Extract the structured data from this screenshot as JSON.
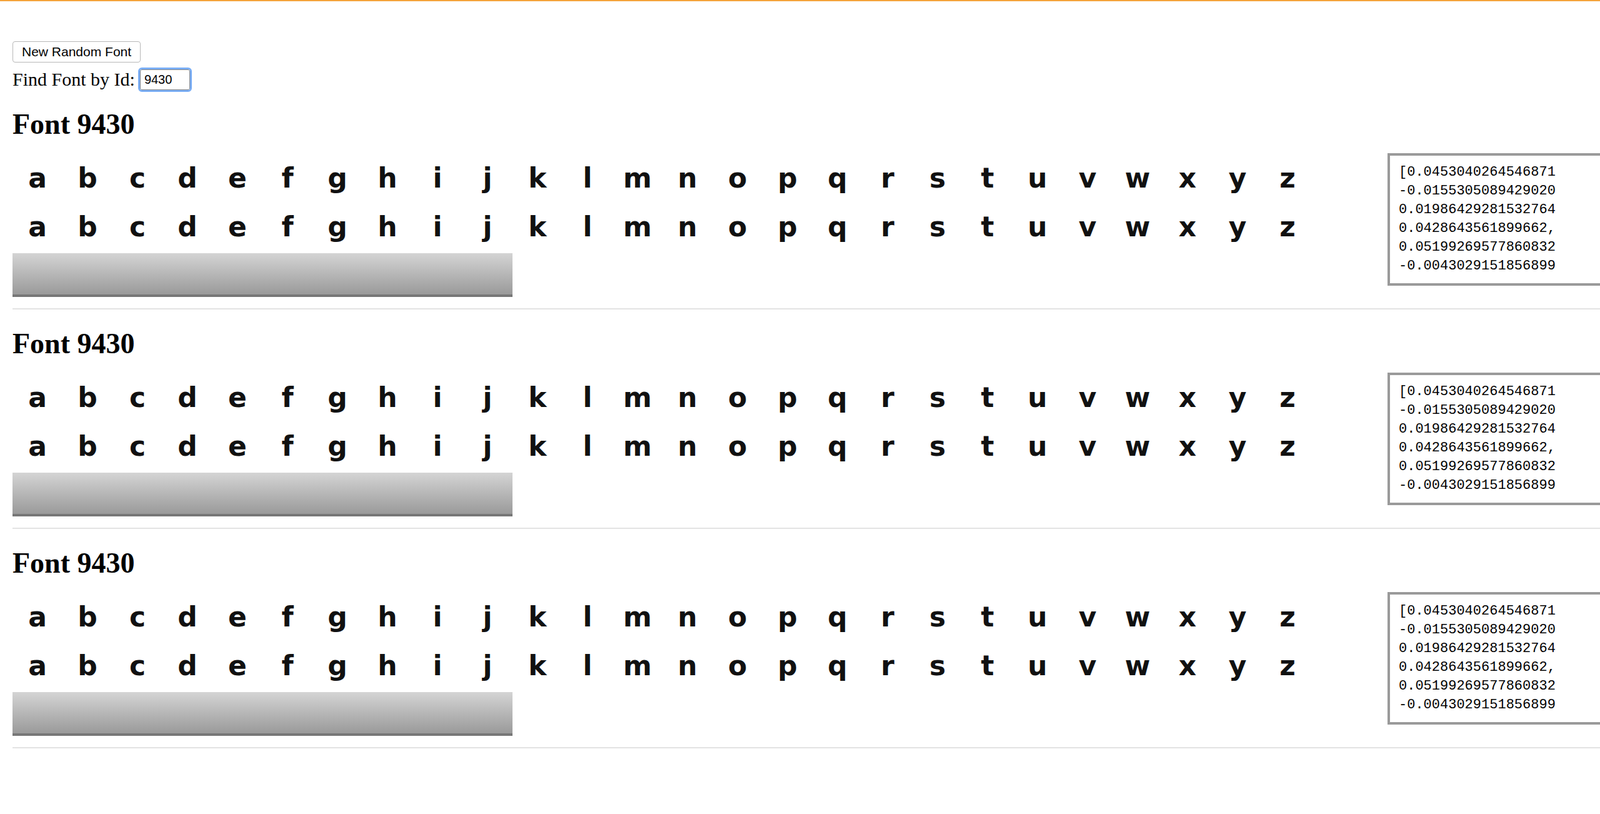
{
  "controls": {
    "random_button": "New Random Font",
    "find_label": "Find Font by Id:",
    "find_value": "9430",
    "find_focused": true
  },
  "sections": [
    {
      "title": "Font 9430",
      "glyph_rows": [
        [
          "a",
          "b",
          "c",
          "d",
          "e",
          "f",
          "g",
          "h",
          "i",
          "j",
          "k",
          "l",
          "m",
          "n",
          "o",
          "p",
          "q",
          "r",
          "s",
          "t",
          "u",
          "v",
          "w",
          "x",
          "y",
          "z"
        ],
        [
          "a",
          "b",
          "c",
          "d",
          "e",
          "f",
          "g",
          "h",
          "i",
          "j",
          "k",
          "l",
          "m",
          "n",
          "o",
          "p",
          "q",
          "r",
          "s",
          "t",
          "u",
          "v",
          "w",
          "x",
          "y",
          "z"
        ]
      ],
      "pictures": [
        {
          "kind": "picture"
        },
        {
          "kind": "picture"
        },
        {
          "kind": "picture"
        },
        {
          "kind": "picture"
        },
        {
          "kind": "picture"
        },
        {
          "kind": "picture"
        },
        {
          "kind": "picture"
        },
        {
          "kind": "picture"
        },
        {
          "kind": "picture"
        },
        {
          "kind": "picture"
        }
      ],
      "vector": [
        "[0.0453040264546871",
        "-0.0155305089429020",
        "0.01986429281532764",
        "0.0428643561899662,",
        "0.05199269577860832",
        "-0.0043029151856899"
      ]
    },
    {
      "title": "Font 9430",
      "glyph_rows": [
        [
          "a",
          "b",
          "c",
          "d",
          "e",
          "f",
          "g",
          "h",
          "i",
          "j",
          "k",
          "l",
          "m",
          "n",
          "o",
          "p",
          "q",
          "r",
          "s",
          "t",
          "u",
          "v",
          "w",
          "x",
          "y",
          "z"
        ],
        [
          "a",
          "b",
          "c",
          "d",
          "e",
          "f",
          "g",
          "h",
          "i",
          "j",
          "k",
          "l",
          "m",
          "n",
          "o",
          "p",
          "q",
          "r",
          "s",
          "t",
          "u",
          "v",
          "w",
          "x",
          "y",
          "z"
        ]
      ],
      "pictures": [
        {
          "kind": "picture"
        },
        {
          "kind": "picture"
        },
        {
          "kind": "picture"
        },
        {
          "kind": "picture"
        },
        {
          "kind": "picture"
        },
        {
          "kind": "picture"
        },
        {
          "kind": "picture"
        },
        {
          "kind": "picture"
        },
        {
          "kind": "picture"
        },
        {
          "kind": "picture"
        }
      ],
      "vector": [
        "[0.0453040264546871",
        "-0.0155305089429020",
        "0.01986429281532764",
        "0.0428643561899662,",
        "0.05199269577860832",
        "-0.0043029151856899"
      ]
    },
    {
      "title": "Font 9430",
      "glyph_rows": [
        [
          "a",
          "b",
          "c",
          "d",
          "e",
          "f",
          "g",
          "h",
          "i",
          "j",
          "k",
          "l",
          "m",
          "n",
          "o",
          "p",
          "q",
          "r",
          "s",
          "t",
          "u",
          "v",
          "w",
          "x",
          "y",
          "z"
        ],
        [
          "a",
          "b",
          "c",
          "d",
          "e",
          "f",
          "g",
          "h",
          "i",
          "j",
          "k",
          "l",
          "m",
          "n",
          "o",
          "p",
          "q",
          "r",
          "s",
          "t",
          "u",
          "v",
          "w",
          "x",
          "y",
          "z"
        ]
      ],
      "pictures": [
        {
          "kind": "picture"
        },
        {
          "kind": "picture"
        },
        {
          "kind": "picture"
        },
        {
          "kind": "picture"
        },
        {
          "kind": "picture"
        },
        {
          "kind": "picture"
        },
        {
          "kind": "picture"
        },
        {
          "kind": "picture"
        },
        {
          "kind": "picture"
        },
        {
          "kind": "picture"
        }
      ],
      "vector": [
        "[0.0453040264546871",
        "-0.0155305089429020",
        "0.01986429281532764",
        "0.0428643561899662,",
        "0.05199269577860832",
        "-0.0043029151856899"
      ]
    }
  ]
}
